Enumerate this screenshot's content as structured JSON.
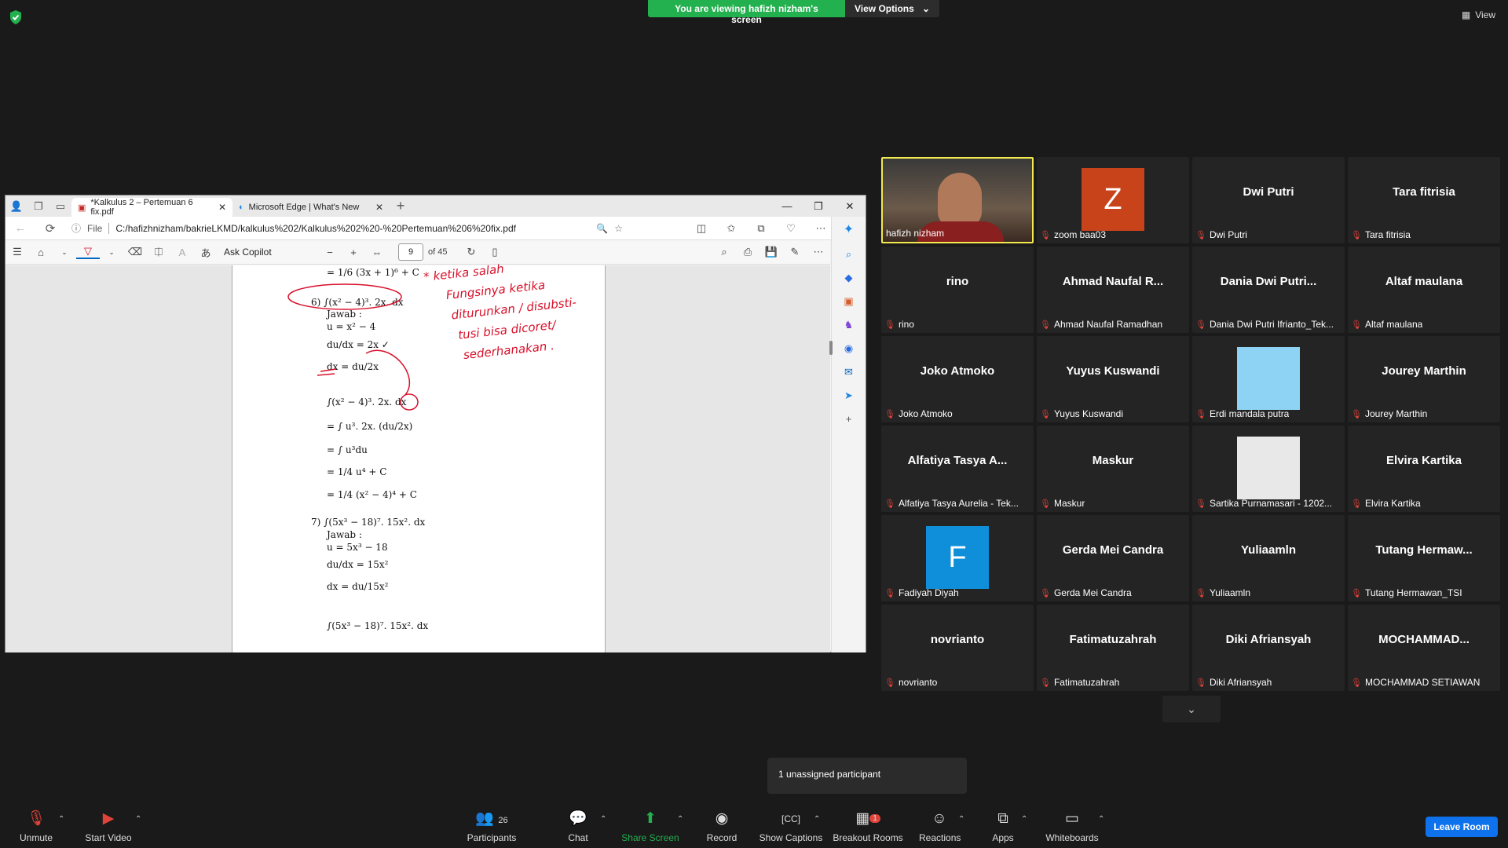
{
  "banner": {
    "message": "You are viewing hafizh nizham's screen",
    "options": "View Options"
  },
  "view_label": "View",
  "browser": {
    "tabs": [
      {
        "label": "*Kalkulus 2 – Pertemuan 6 fix.pdf"
      },
      {
        "label": "Microsoft Edge | What's New"
      }
    ],
    "address_prefix": "File",
    "address": "C:/hafizhnizham/bakrieLKMD/kalkulus%202/Kalkulus%202%20-%20Pertemuan%206%20fix.pdf",
    "ask_copilot": "Ask Copilot",
    "page_number": "9",
    "page_total": "of 45"
  },
  "pdf_lines": [
    "= 1/6 (3x + 1)⁶ + C",
    "6)  ∫(x² − 4)³. 2x. dx",
    "Jawab :",
    "u = x² − 4",
    "du/dx = 2x ✓",
    "dx = du/2x",
    "∫(x² − 4)³. 2x. dx",
    "= ∫ u³. 2x. (du/2x)",
    "= ∫ u³du",
    "= 1/4 u⁴ + C",
    "= 1/4 (x² − 4)⁴ + C",
    "7)  ∫(5x³ − 18)⁷. 15x². dx",
    "Jawab :",
    "u = 5x³ − 18",
    "du/dx = 15x²",
    "dx = du/15x²",
    "∫(5x³ − 18)⁷. 15x². dx"
  ],
  "annotation": [
    "* ketika salah",
    "Fungsinya ketika",
    "diturunkan / disubsti-",
    "tusi bisa dicoret/",
    "sederhanakan ."
  ],
  "participants": [
    {
      "display": "",
      "name": "hafizh nizham",
      "video": true
    },
    {
      "display": "Z",
      "name": "zoom baa03",
      "avatar_color": "#c8431a"
    },
    {
      "display": "Dwi Putri",
      "name": "Dwi Putri"
    },
    {
      "display": "Tara fitrisia",
      "name": "Tara fitrisia"
    },
    {
      "display": "rino",
      "name": "rino"
    },
    {
      "display": "Ahmad Naufal R...",
      "name": "Ahmad Naufal Ramadhan"
    },
    {
      "display": "Dania Dwi Putri...",
      "name": "Dania Dwi Putri Ifrianto_Tek..."
    },
    {
      "display": "Altaf maulana",
      "name": "Altaf maulana"
    },
    {
      "display": "Joko Atmoko",
      "name": "Joko Atmoko"
    },
    {
      "display": "Yuyus Kuswandi",
      "name": "Yuyus Kuswandi"
    },
    {
      "display": "",
      "name": "Erdi mandala putra",
      "avatar_color": "#8fd3f4"
    },
    {
      "display": "Jourey Marthin",
      "name": "Jourey Marthin"
    },
    {
      "display": "Alfatiya Tasya A...",
      "name": "Alfatiya Tasya Aurelia - Tek..."
    },
    {
      "display": "Maskur",
      "name": "Maskur"
    },
    {
      "display": "",
      "name": "Sartika Purnamasari - 1202...",
      "avatar_color": "#e8e8e8"
    },
    {
      "display": "Elvira Kartika",
      "name": "Elvira Kartika"
    },
    {
      "display": "F",
      "name": "Fadiyah Diyah",
      "avatar_color": "#0f8fd9"
    },
    {
      "display": "Gerda Mei Candra",
      "name": "Gerda Mei Candra"
    },
    {
      "display": "Yuliaamln",
      "name": "Yuliaamln"
    },
    {
      "display": "Tutang Hermaw...",
      "name": "Tutang Hermawan_TSI"
    },
    {
      "display": "novrianto",
      "name": "novrianto"
    },
    {
      "display": "Fatimatuzahrah",
      "name": "Fatimatuzahrah"
    },
    {
      "display": "Diki Afriansyah",
      "name": "Diki Afriansyah"
    },
    {
      "display": "MOCHAMMAD...",
      "name": "MOCHAMMAD SETIAWAN"
    }
  ],
  "unassigned": "1 unassigned participant",
  "toolbar": {
    "unmute": "Unmute",
    "start_video": "Start Video",
    "participants": "Participants",
    "participants_count": "26",
    "chat": "Chat",
    "share_screen": "Share Screen",
    "record": "Record",
    "captions": "Show Captions",
    "breakout": "Breakout Rooms",
    "breakout_badge": "1",
    "reactions": "Reactions",
    "apps": "Apps",
    "whiteboards": "Whiteboards",
    "leave": "Leave Room"
  },
  "colors": {
    "share_green": "#23b04e",
    "leave_blue": "#0e72ed",
    "mute_red": "#e0433a",
    "active_speaker": "#f2e94e",
    "ink_red": "#d8102a"
  }
}
